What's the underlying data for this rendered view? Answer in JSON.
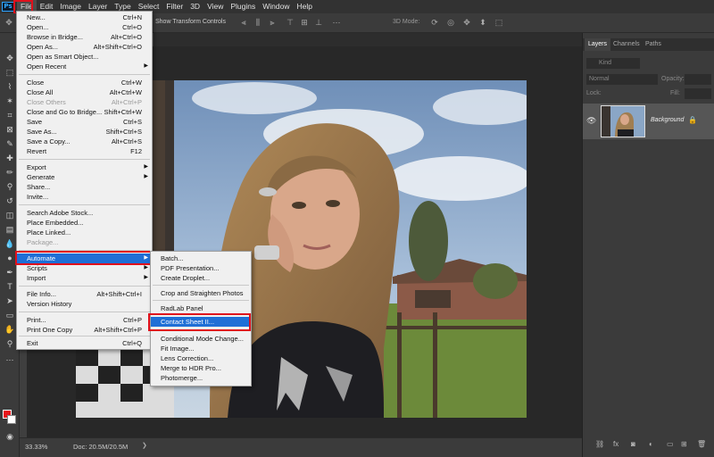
{
  "menubar": {
    "logo": "Ps",
    "items": [
      "File",
      "Edit",
      "Image",
      "Layer",
      "Type",
      "Select",
      "Filter",
      "3D",
      "View",
      "Plugins",
      "Window",
      "Help"
    ]
  },
  "options": {
    "transform_label": "Show Transform Controls",
    "mode_3d": "3D Mode:"
  },
  "status": {
    "zoom": "33.33%",
    "doc": "Doc: 20.5M/20.5M"
  },
  "panels": {
    "tabs": [
      "Layers",
      "Channels",
      "Paths"
    ],
    "kind": "Kind",
    "blend": "Normal",
    "opacity_label": "Opacity:",
    "lock_label": "Lock:",
    "fill_label": "Fill:",
    "layer_name": "Background"
  },
  "file_menu": {
    "items": [
      {
        "label": "New...",
        "shortcut": "Ctrl+N"
      },
      {
        "label": "Open...",
        "shortcut": "Ctrl+O"
      },
      {
        "label": "Browse in Bridge...",
        "shortcut": "Alt+Ctrl+O"
      },
      {
        "label": "Open As...",
        "shortcut": "Alt+Shift+Ctrl+O"
      },
      {
        "label": "Open as Smart Object...",
        "shortcut": ""
      },
      {
        "label": "Open Recent",
        "shortcut": ""
      },
      {
        "label": "Close",
        "shortcut": "Ctrl+W"
      },
      {
        "label": "Close All",
        "shortcut": "Alt+Ctrl+W"
      },
      {
        "label": "Close Others",
        "shortcut": "Alt+Ctrl+P"
      },
      {
        "label": "Close and Go to Bridge...",
        "shortcut": "Shift+Ctrl+W"
      },
      {
        "label": "Save",
        "shortcut": "Ctrl+S"
      },
      {
        "label": "Save As...",
        "shortcut": "Shift+Ctrl+S"
      },
      {
        "label": "Save a Copy...",
        "shortcut": "Alt+Ctrl+S"
      },
      {
        "label": "Revert",
        "shortcut": "F12"
      },
      {
        "label": "Export",
        "shortcut": ""
      },
      {
        "label": "Generate",
        "shortcut": ""
      },
      {
        "label": "Share...",
        "shortcut": ""
      },
      {
        "label": "Invite...",
        "shortcut": ""
      },
      {
        "label": "Search Adobe Stock...",
        "shortcut": ""
      },
      {
        "label": "Place Embedded...",
        "shortcut": ""
      },
      {
        "label": "Place Linked...",
        "shortcut": ""
      },
      {
        "label": "Package...",
        "shortcut": ""
      },
      {
        "label": "Automate",
        "shortcut": ""
      },
      {
        "label": "Scripts",
        "shortcut": ""
      },
      {
        "label": "Import",
        "shortcut": ""
      },
      {
        "label": "File Info...",
        "shortcut": "Alt+Shift+Ctrl+I"
      },
      {
        "label": "Version History",
        "shortcut": ""
      },
      {
        "label": "Print...",
        "shortcut": "Ctrl+P"
      },
      {
        "label": "Print One Copy",
        "shortcut": "Alt+Shift+Ctrl+P"
      },
      {
        "label": "Exit",
        "shortcut": "Ctrl+Q"
      }
    ]
  },
  "automate_menu": {
    "items": [
      "Batch...",
      "PDF Presentation...",
      "Create Droplet...",
      "Crop and Straighten Photos",
      "RadLab Panel",
      "Contact Sheet II...",
      "Conditional Mode Change...",
      "Fit Image...",
      "Lens Correction...",
      "Merge to HDR Pro...",
      "Photomerge..."
    ]
  }
}
